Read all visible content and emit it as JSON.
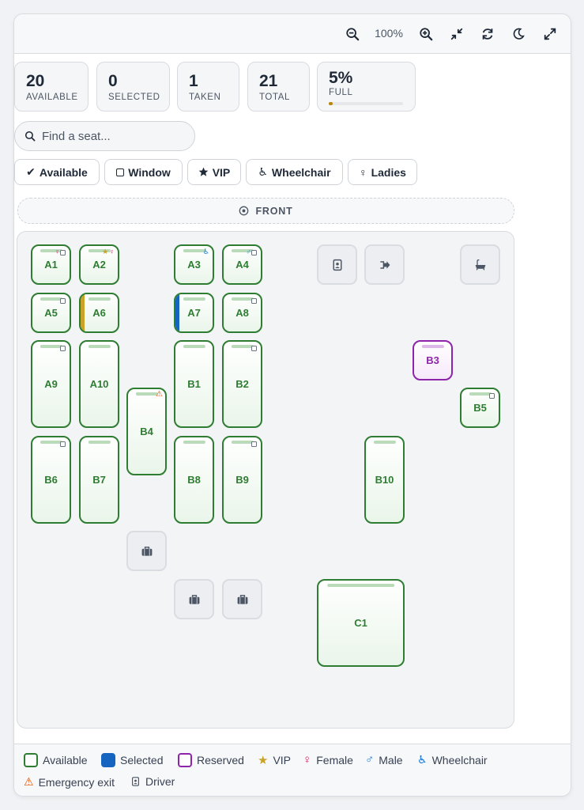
{
  "toolbar": {
    "zoom_level": "100%",
    "buttons": [
      "zoom-out-icon",
      "zoom-in-icon",
      "collapse-icon",
      "refresh-icon",
      "dark-mode-icon",
      "fullscreen-icon"
    ]
  },
  "stats": {
    "available": {
      "num": "20",
      "label": "AVAILABLE"
    },
    "selected": {
      "num": "0",
      "label": "SELECTED"
    },
    "taken": {
      "num": "1",
      "label": "TAKEN"
    },
    "total": {
      "num": "21",
      "label": "TOTAL"
    },
    "full": {
      "num": "5%",
      "label": "FULL",
      "fraction": 0.05
    }
  },
  "search": {
    "placeholder": "Find a seat..."
  },
  "filters": {
    "available": "Available",
    "window": "Window",
    "vip": "VIP",
    "wheelchair": "Wheelchair",
    "ladies": "Ladies"
  },
  "front_label": "FRONT",
  "seats": {
    "A1": "A1",
    "A2": "A2",
    "A3": "A3",
    "A4": "A4",
    "A5": "A5",
    "A6": "A6",
    "A7": "A7",
    "A8": "A8",
    "A9": "A9",
    "A10": "A10",
    "B1": "B1",
    "B2": "B2",
    "B3": "B3",
    "B4": "B4",
    "B5": "B5",
    "B6": "B6",
    "B7": "B7",
    "B8": "B8",
    "B9": "B9",
    "B10": "B10",
    "C1": "C1"
  },
  "colors": {
    "available": "#2e7d32",
    "selected": "#1565c0",
    "reserved": "#8e24aa",
    "vip": "#c9a227",
    "female": "#d81b60",
    "male": "#1976d2",
    "emergency": "#e65100"
  },
  "legend": {
    "available": "Available",
    "selected": "Selected",
    "reserved": "Reserved",
    "vip": "VIP",
    "female": "Female",
    "male": "Male",
    "wheelchair": "Wheelchair",
    "emergency": "Emergency exit",
    "driver": "Driver"
  },
  "glyphs": {
    "female": "♀",
    "male": "♂",
    "vip": "★",
    "wheelchair": "♿",
    "emergency": "⚠",
    "check": "✔"
  }
}
